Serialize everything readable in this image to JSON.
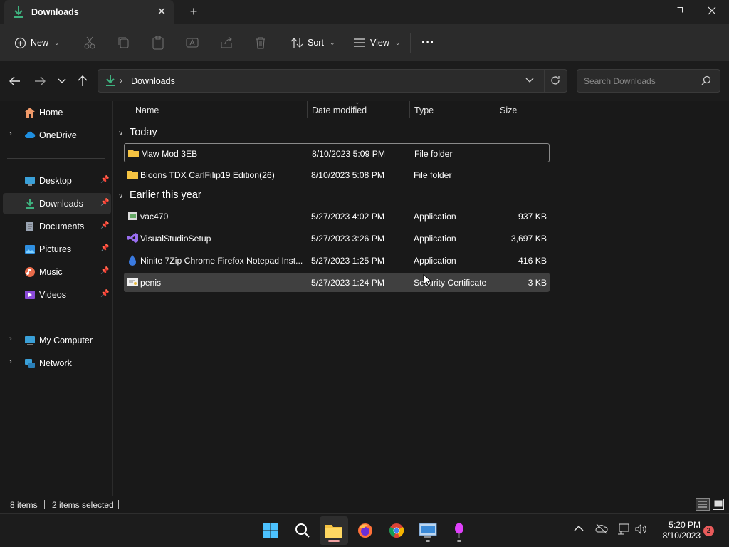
{
  "window": {
    "tab_title": "Downloads",
    "colors": {
      "accent_download": "#3fb27f",
      "folder": "#f5c342"
    }
  },
  "commandbar": {
    "new_label": "New",
    "sort_label": "Sort",
    "view_label": "View",
    "more_label": "···"
  },
  "address": {
    "path": "Downloads",
    "search_placeholder": "Search Downloads"
  },
  "sidebar": {
    "items": [
      {
        "label": "Home",
        "icon": "home-icon"
      },
      {
        "label": "OneDrive",
        "icon": "cloud-icon"
      },
      {
        "label": "Desktop",
        "icon": "desktop-icon"
      },
      {
        "label": "Downloads",
        "icon": "download-icon"
      },
      {
        "label": "Documents",
        "icon": "document-icon"
      },
      {
        "label": "Pictures",
        "icon": "picture-icon"
      },
      {
        "label": "Music",
        "icon": "music-icon"
      },
      {
        "label": "Videos",
        "icon": "video-icon"
      },
      {
        "label": "My Computer",
        "icon": "computer-icon"
      },
      {
        "label": "Network",
        "icon": "network-icon"
      }
    ]
  },
  "columns": {
    "name": "Name",
    "date": "Date modified",
    "type": "Type",
    "size": "Size"
  },
  "groups": {
    "today": "Today",
    "earlier": "Earlier this year"
  },
  "files": [
    {
      "name": "Maw Mod 3EB",
      "date": "8/10/2023 5:09 PM",
      "type": "File folder",
      "size": "",
      "icon": "folder-icon"
    },
    {
      "name": "Bloons TDX CarlFilip19 Edition(26)",
      "date": "8/10/2023 5:08 PM",
      "type": "File folder",
      "size": "",
      "icon": "folder-icon"
    },
    {
      "name": "vac470",
      "date": "5/27/2023 4:02 PM",
      "type": "Application",
      "size": "937 KB",
      "icon": "app-icon"
    },
    {
      "name": "VisualStudioSetup",
      "date": "5/27/2023 3:26 PM",
      "type": "Application",
      "size": "3,697 KB",
      "icon": "visual-studio-icon"
    },
    {
      "name": "Ninite 7Zip Chrome Firefox Notepad Inst...",
      "date": "5/27/2023 1:25 PM",
      "type": "Application",
      "size": "416 KB",
      "icon": "ninite-icon"
    },
    {
      "name": "penis",
      "date": "5/27/2023 1:24 PM",
      "type": "Security Certificate",
      "size": "3 KB",
      "icon": "certificate-icon"
    }
  ],
  "status": {
    "items_count": "8 items",
    "selected_count": "2 items selected"
  },
  "taskbar": {
    "time": "5:20 PM",
    "date": "8/10/2023",
    "notification_count": "2"
  }
}
